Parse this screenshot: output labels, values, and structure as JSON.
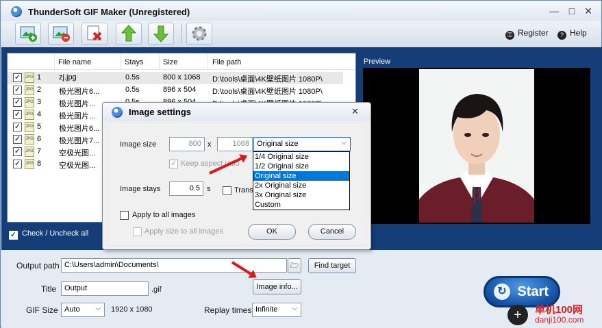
{
  "app": {
    "title": "ThunderSoft GIF Maker (Unregistered)",
    "register": "Register",
    "help": "Help"
  },
  "toolbar": {
    "icons": [
      "add-image-icon",
      "remove-image-icon",
      "clear-icon",
      "move-up-icon",
      "move-down-icon",
      "settings-icon"
    ]
  },
  "list": {
    "headers": {
      "name": "File name",
      "stays": "Stays",
      "size": "Size",
      "path": "File path"
    },
    "rows": [
      {
        "n": "1",
        "name": "zj.jpg",
        "stays": "0.5s",
        "size": "800 x 1068",
        "path": "D:\\tools\\桌面\\4K壁纸图片 1080P\\"
      },
      {
        "n": "2",
        "name": "极光图片6...",
        "stays": "0.5s",
        "size": "896 x 504",
        "path": "D:\\tools\\桌面\\4K壁纸图片 1080P\\"
      },
      {
        "n": "3",
        "name": "极光图片...",
        "stays": "0.5s",
        "size": "896 x 504",
        "path": "D:\\tools\\桌面\\4K壁纸图片 1080P\\"
      },
      {
        "n": "4",
        "name": "极光图片...",
        "stays": "",
        "size": "",
        "path": ""
      },
      {
        "n": "5",
        "name": "极光图片6...",
        "stays": "",
        "size": "",
        "path": ""
      },
      {
        "n": "6",
        "name": "极光图片7...",
        "stays": "",
        "size": "",
        "path": ""
      },
      {
        "n": "7",
        "name": "空极光图...",
        "stays": "",
        "size": "",
        "path": ""
      },
      {
        "n": "8",
        "name": "空极光图...",
        "stays": "",
        "size": "",
        "path": ""
      }
    ],
    "check_all": "Check / Uncheck all"
  },
  "preview": {
    "label": "Preview"
  },
  "output": {
    "path_label": "Output path",
    "path": "C:\\Users\\admin\\Documents\\",
    "find_target": "Find target",
    "title_label": "Title",
    "title": "Output",
    "ext": ".gif",
    "image_info": "Image info...",
    "gif_size_label": "GIF Size",
    "gif_size": "Auto",
    "resolution": "1920 x 1080",
    "replay_label": "Replay times",
    "replay": "Infinite",
    "start": "Start"
  },
  "dialog": {
    "title": "Image settings",
    "image_size_label": "Image size",
    "width": "800",
    "x": "x",
    "height": "1068",
    "size_select": "Original size",
    "keep_aspect": "Keep aspect ratio",
    "stays_label": "Image stays",
    "stays": "0.5",
    "stays_unit": "s",
    "trans": "Trans",
    "apply_all": "Apply to all images",
    "apply_size_all": "Apply size to all images",
    "ok": "OK",
    "cancel": "Cancel",
    "options": [
      "1/4 Original size",
      "1/2 Original size",
      "Original size",
      "2x Original size",
      "3x Original size",
      "Custom"
    ]
  },
  "watermark": {
    "t1": "单机100网",
    "t2": "danji100.com"
  }
}
